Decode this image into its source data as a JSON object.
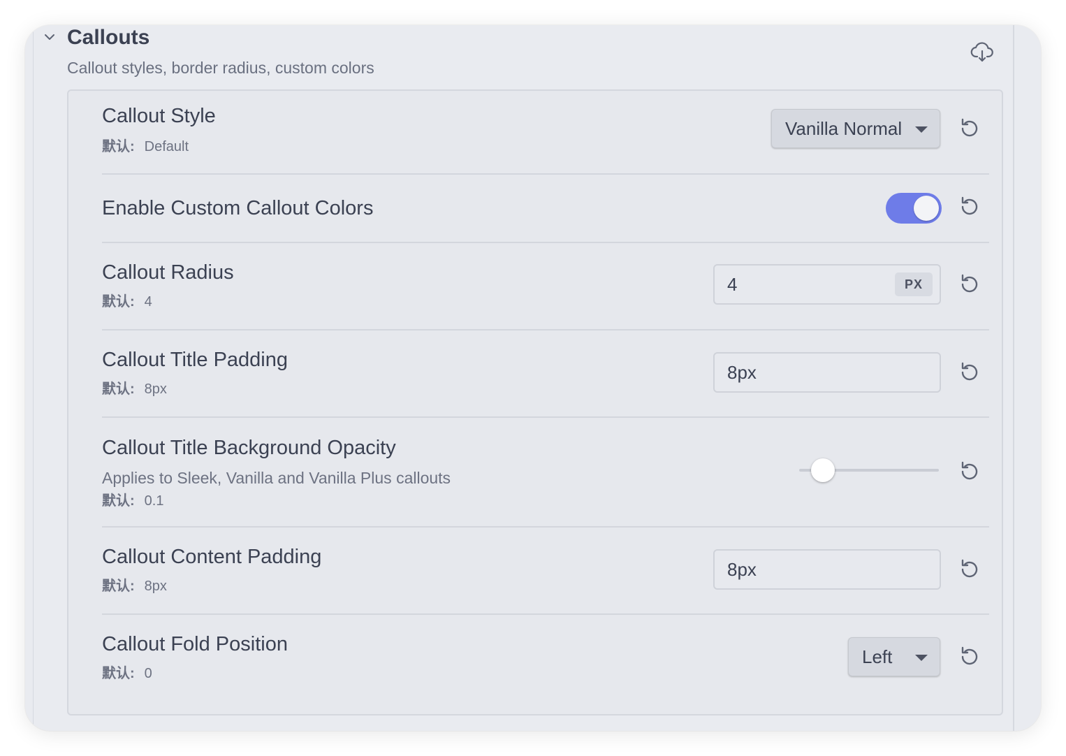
{
  "section": {
    "title": "Callouts",
    "subtitle": "Callout styles, border radius, custom colors"
  },
  "default_label": "默认:",
  "settings": [
    {
      "title": "Callout Style",
      "default": "Default",
      "control": "dropdown",
      "value": "Vanilla Normal"
    },
    {
      "title": "Enable Custom Callout Colors",
      "control": "toggle",
      "value": true
    },
    {
      "title": "Callout Radius",
      "default": "4",
      "control": "number",
      "value": "4",
      "unit": "PX"
    },
    {
      "title": "Callout Title Padding",
      "default": "8px",
      "control": "text",
      "value": "8px"
    },
    {
      "title": "Callout Title Background Opacity",
      "description": "Applies to Sleek, Vanilla and Vanilla Plus callouts",
      "default": "0.1",
      "control": "slider",
      "value": 0.1
    },
    {
      "title": "Callout Content Padding",
      "default": "8px",
      "control": "text",
      "value": "8px"
    },
    {
      "title": "Callout Fold Position",
      "default": "0",
      "control": "dropdown",
      "value": "Left"
    }
  ],
  "icons": {
    "section_toggle": "chevron-down-icon",
    "section_action": "cloud-download-icon",
    "reset": "reset-icon"
  },
  "colors": {
    "toggle_on": "#6e7ce8",
    "window_bg": "#e9ebf0"
  }
}
